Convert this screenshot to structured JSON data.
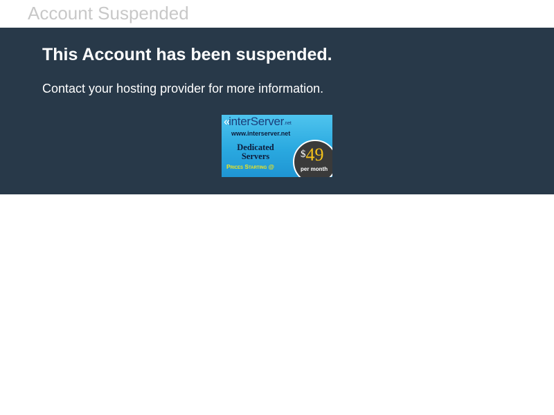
{
  "page": {
    "title": "Account Suspended"
  },
  "banner": {
    "heading": "This Account has been suspended.",
    "message": "Contact your hosting provider for more information."
  },
  "ad": {
    "logo_glyph": "«",
    "logo_text": "interServer",
    "logo_tld": ".net",
    "url": "www.interserver.net",
    "product_line1": "Dedicated",
    "product_line2": "Servers",
    "prices_text": "Prices Starting @",
    "currency": "$",
    "price": "49",
    "period": "per month"
  },
  "colors": {
    "banner_bg": "#283949",
    "page_title": "#c8c8c8",
    "text": "#ffffff",
    "ad_blue": "#2aa9e0",
    "ad_price": "#f5c21a"
  }
}
